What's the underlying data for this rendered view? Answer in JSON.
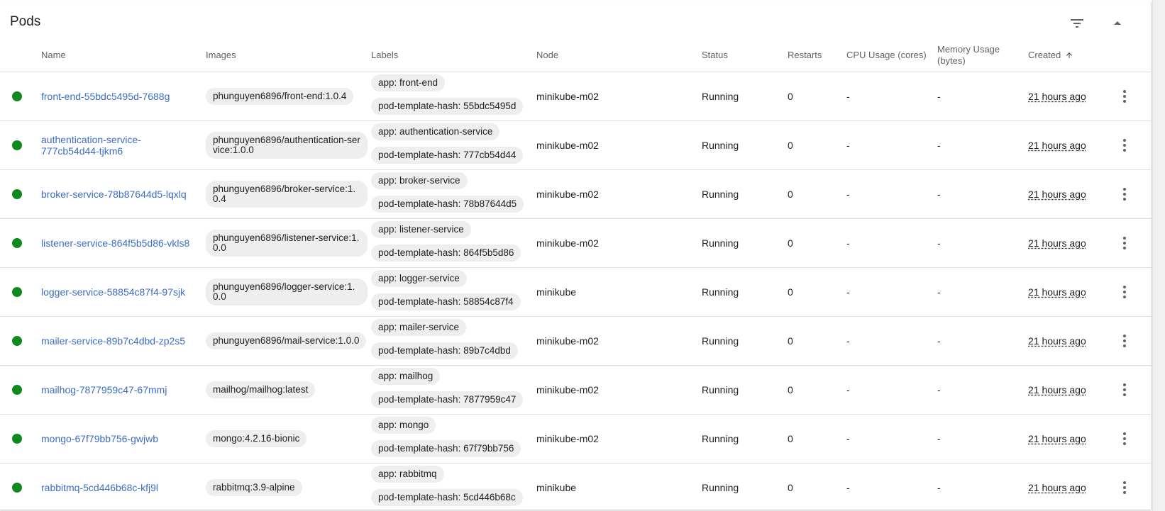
{
  "card": {
    "title": "Pods"
  },
  "header_buttons": {
    "filter_icon": "filter-list-icon",
    "collapse_icon": "expand-less-icon"
  },
  "columns": {
    "name": "Name",
    "images": "Images",
    "labels": "Labels",
    "node": "Node",
    "status": "Status",
    "restarts": "Restarts",
    "cpu": "CPU Usage (cores)",
    "memory": "Memory Usage (bytes)",
    "created": "Created"
  },
  "status_color": "#0f8a1d",
  "link_color": "#3d6cc4",
  "pods": [
    {
      "name": "front-end-55bdc5495d-7688g",
      "image": "phunguyen6896/front-end:1.0.4",
      "label_app": "app: front-end",
      "label_hash": "pod-template-hash: 55bdc5495d",
      "node": "minikube-m02",
      "status": "Running",
      "restarts": "0",
      "cpu": "-",
      "memory": "-",
      "created": "21 hours ago"
    },
    {
      "name": "authentication-service-777cb54d44-tjkm6",
      "image": "phunguyen6896/authentication-service:1.0.0",
      "label_app": "app: authentication-service",
      "label_hash": "pod-template-hash: 777cb54d44",
      "node": "minikube-m02",
      "status": "Running",
      "restarts": "0",
      "cpu": "-",
      "memory": "-",
      "created": "21 hours ago"
    },
    {
      "name": "broker-service-78b87644d5-lqxlq",
      "image": "phunguyen6896/broker-service:1.0.4",
      "label_app": "app: broker-service",
      "label_hash": "pod-template-hash: 78b87644d5",
      "node": "minikube-m02",
      "status": "Running",
      "restarts": "0",
      "cpu": "-",
      "memory": "-",
      "created": "21 hours ago"
    },
    {
      "name": "listener-service-864f5b5d86-vkls8",
      "image": "phunguyen6896/listener-service:1.0.0",
      "label_app": "app: listener-service",
      "label_hash": "pod-template-hash: 864f5b5d86",
      "node": "minikube-m02",
      "status": "Running",
      "restarts": "0",
      "cpu": "-",
      "memory": "-",
      "created": "21 hours ago"
    },
    {
      "name": "logger-service-58854c87f4-97sjk",
      "image": "phunguyen6896/logger-service:1.0.0",
      "label_app": "app: logger-service",
      "label_hash": "pod-template-hash: 58854c87f4",
      "node": "minikube",
      "status": "Running",
      "restarts": "0",
      "cpu": "-",
      "memory": "-",
      "created": "21 hours ago"
    },
    {
      "name": "mailer-service-89b7c4dbd-zp2s5",
      "image": "phunguyen6896/mail-service:1.0.0",
      "label_app": "app: mailer-service",
      "label_hash": "pod-template-hash: 89b7c4dbd",
      "node": "minikube-m02",
      "status": "Running",
      "restarts": "0",
      "cpu": "-",
      "memory": "-",
      "created": "21 hours ago"
    },
    {
      "name": "mailhog-7877959c47-67mmj",
      "image": "mailhog/mailhog:latest",
      "label_app": "app: mailhog",
      "label_hash": "pod-template-hash: 7877959c47",
      "node": "minikube-m02",
      "status": "Running",
      "restarts": "0",
      "cpu": "-",
      "memory": "-",
      "created": "21 hours ago"
    },
    {
      "name": "mongo-67f79bb756-gwjwb",
      "image": "mongo:4.2.16-bionic",
      "label_app": "app: mongo",
      "label_hash": "pod-template-hash: 67f79bb756",
      "node": "minikube-m02",
      "status": "Running",
      "restarts": "0",
      "cpu": "-",
      "memory": "-",
      "created": "21 hours ago"
    },
    {
      "name": "rabbitmq-5cd446b68c-kfj9l",
      "image": "rabbitmq:3.9-alpine",
      "label_app": "app: rabbitmq",
      "label_hash": "pod-template-hash: 5cd446b68c",
      "node": "minikube",
      "status": "Running",
      "restarts": "0",
      "cpu": "-",
      "memory": "-",
      "created": "21 hours ago"
    }
  ]
}
